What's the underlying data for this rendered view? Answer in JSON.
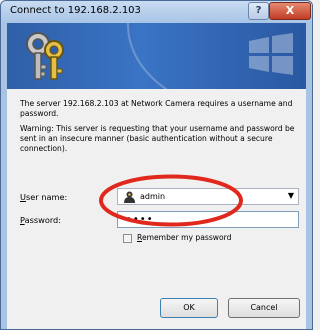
{
  "window": {
    "title": "Connect to 192.168.2.103",
    "help_label": "?",
    "close_label": "X"
  },
  "message": {
    "server_text": "The server 192.168.2.103 at Network Camera requires a username and password.",
    "warning_text": "Warning: This server is requesting that your username and password be sent in an insecure manner (basic authentication without a secure connection)."
  },
  "form": {
    "user_label_key": "U",
    "user_label_rest": "ser name:",
    "username_value": "admin",
    "password_label_key": "P",
    "password_label_rest": "assword:",
    "password_mask": "••••",
    "remember_key": "R",
    "remember_rest": "emember my password",
    "remember_checked": false
  },
  "buttons": {
    "ok": "OK",
    "cancel": "Cancel"
  },
  "annotation": {
    "color": "#e0281c"
  }
}
